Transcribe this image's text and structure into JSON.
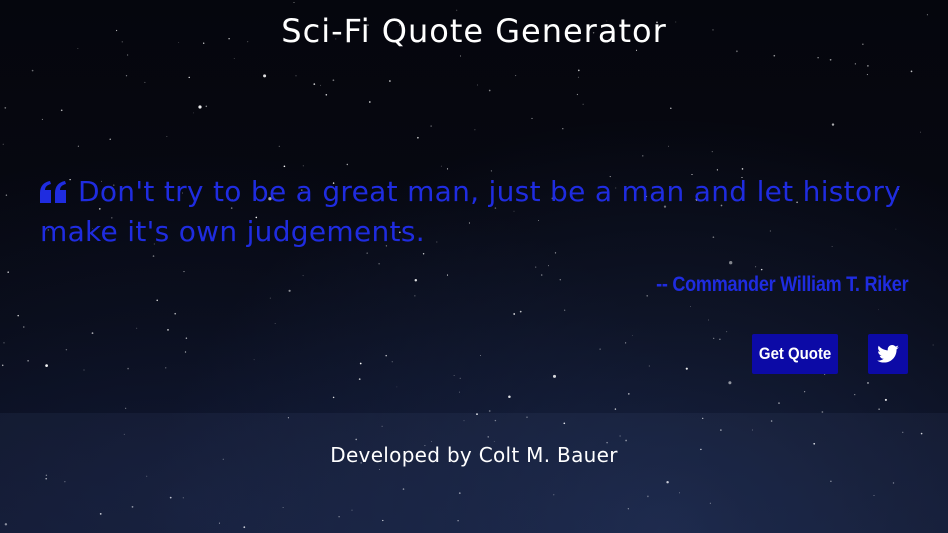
{
  "header": {
    "title": "Sci-Fi Quote Generator"
  },
  "quote": {
    "icon": "quote-left-icon",
    "text": "Don't try to be a great man, just be a man and let history make it's own judgements.",
    "author": "-- Commander William T. Riker"
  },
  "actions": {
    "get_quote_label": "Get Quote",
    "twitter_icon": "twitter-icon"
  },
  "footer": {
    "credit": "Developed by Colt M. Bauer"
  },
  "colors": {
    "background": "#04050c",
    "quote_text": "#1f2ce0",
    "button_bg": "#0c0aa6",
    "title_text": "#ffffff"
  }
}
